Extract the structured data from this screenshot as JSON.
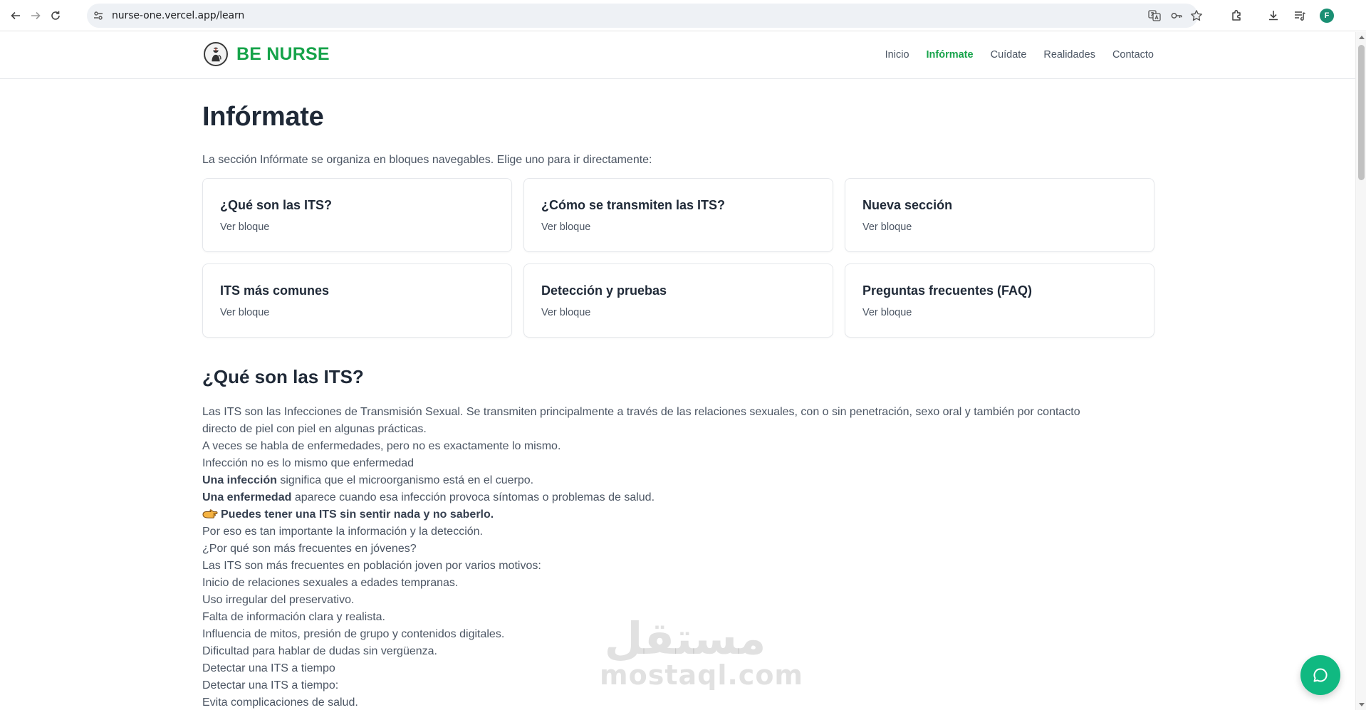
{
  "browser": {
    "url": "nurse-one.vercel.app/learn",
    "profile_initial": "F",
    "icons": [
      "back-icon",
      "forward-icon",
      "reload-icon",
      "site-info-icon",
      "translate-icon",
      "password-key-icon",
      "bookmark-star-icon",
      "extensions-icon",
      "download-icon",
      "reading-list-icon"
    ]
  },
  "header": {
    "logo_text": "BE NURSE",
    "nav": [
      {
        "label": "Inicio",
        "active": false
      },
      {
        "label": "Infórmate",
        "active": true
      },
      {
        "label": "Cuídate",
        "active": false
      },
      {
        "label": "Realidades",
        "active": false
      },
      {
        "label": "Contacto",
        "active": false
      }
    ]
  },
  "page": {
    "title": "Infórmate",
    "intro": "La sección Infórmate se organiza en bloques navegables. Elige uno para ir directamente:",
    "cards": [
      {
        "title": "¿Qué son las ITS?",
        "link": "Ver bloque"
      },
      {
        "title": "¿Cómo se transmiten las ITS?",
        "link": "Ver bloque"
      },
      {
        "title": "Nueva sección",
        "link": "Ver bloque"
      },
      {
        "title": "ITS más comunes",
        "link": "Ver bloque"
      },
      {
        "title": "Detección y pruebas",
        "link": "Ver bloque"
      },
      {
        "title": "Preguntas frecuentes (FAQ)",
        "link": "Ver bloque"
      }
    ],
    "section": {
      "title": "¿Qué son las ITS?",
      "lines": [
        "Las ITS son las Infecciones de Transmisión Sexual. Se transmiten principalmente a través de las relaciones sexuales, con o sin penetración, sexo oral y también por contacto",
        "directo de piel con piel en algunas prácticas.",
        "A veces se habla de enfermedades, pero no es exactamente lo mismo.",
        "Infección no es lo mismo que enfermedad"
      ],
      "infeccion_bold": "Una infección",
      "infeccion_rest": " significa que el microorganismo está en el cuerpo.",
      "enfermedad_bold": "Una enfermedad",
      "enfermedad_rest": " aparece cuando esa infección provoca síntomas o problemas de salud.",
      "highlight": "Puedes tener una ITS sin sentir nada y no saberlo.",
      "lines_after": [
        "Por eso es tan importante la información y la detección.",
        "¿Por qué son más frecuentes en jóvenes?",
        "Las ITS son más frecuentes en población joven por varios motivos:",
        "Inicio de relaciones sexuales a edades tempranas.",
        "Uso irregular del preservativo.",
        "Falta de información clara y realista.",
        "Influencia de mitos, presión de grupo y contenidos digitales.",
        "Dificultad para hablar de dudas sin vergüenza.",
        "Detectar una ITS a tiempo",
        "Detectar una ITS a tiempo:",
        "Evita complicaciones de salud."
      ]
    }
  },
  "watermark": {
    "arabic": "مستقل",
    "latin": "mostaql.com"
  },
  "colors": {
    "brand_green": "#16a34a",
    "fab_green": "#10b981",
    "text": "#1f2937",
    "muted": "#4b5563"
  }
}
